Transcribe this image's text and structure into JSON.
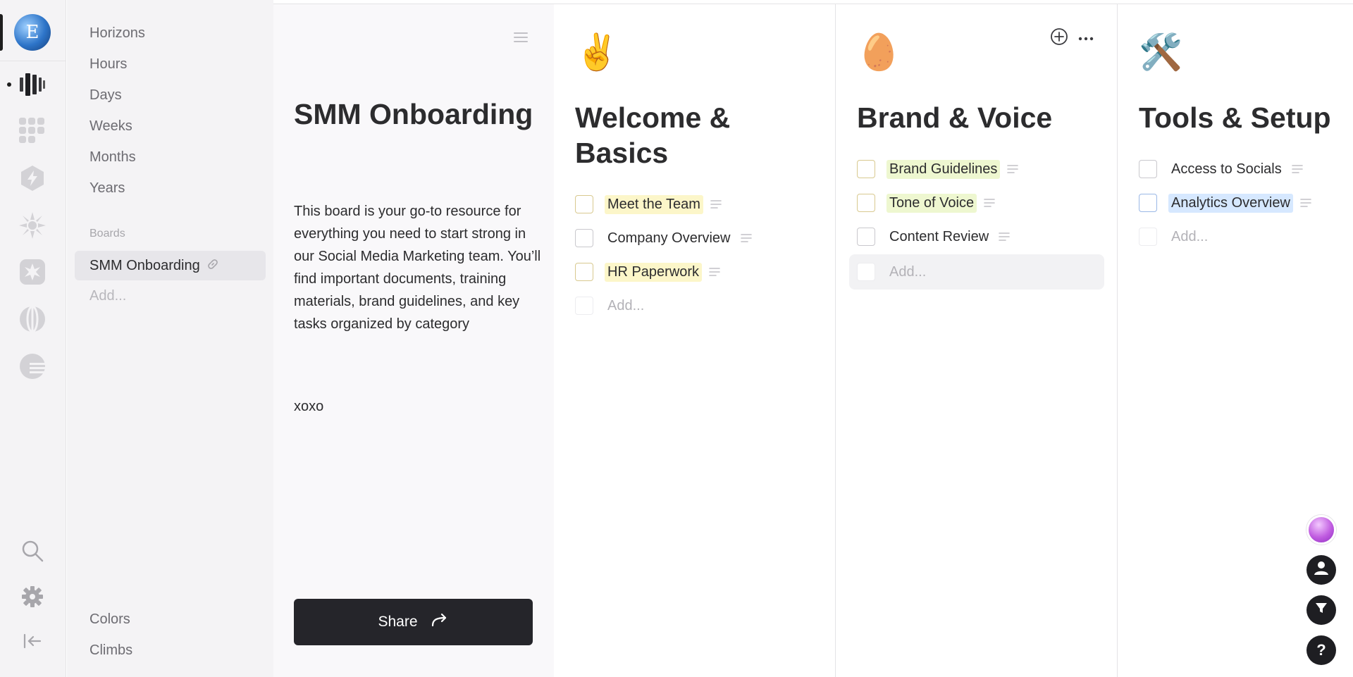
{
  "rail": {
    "avatar_letter": "E",
    "icons": [
      "timeline-icon",
      "grid-icon",
      "bolt-icon",
      "snowflake-icon",
      "sparkle-icon",
      "globe-icon",
      "sunset-icon"
    ],
    "bottom_icons": [
      "search-icon",
      "gear-icon",
      "collapse-icon"
    ]
  },
  "sidebar": {
    "nav": [
      "Horizons",
      "Hours",
      "Days",
      "Weeks",
      "Months",
      "Years"
    ],
    "boards_heading": "Boards",
    "active_board": "SMM Onboarding",
    "add_label": "Add...",
    "footer": [
      "Colors",
      "Climbs"
    ]
  },
  "intro": {
    "title": "SMM Onboarding",
    "description": "This board is your go-to resource for everything you need to start strong in our Social Media Marketing team. You’ll find important documents, training materials, brand guidelines, and key tasks organized by category",
    "signoff": "xoxo",
    "share_label": "Share"
  },
  "columns": [
    {
      "emoji": "✌️",
      "title": "Welcome & Basics",
      "tasks": [
        {
          "label": "Meet the Team",
          "highlight": "yellow"
        },
        {
          "label": "Company Overview",
          "highlight": "none"
        },
        {
          "label": "HR Paperwork",
          "highlight": "yellow"
        }
      ],
      "add_label": "Add..."
    },
    {
      "emoji": "🥚",
      "title": "Brand & Voice",
      "tasks": [
        {
          "label": "Brand Guidelines",
          "highlight": "green"
        },
        {
          "label": "Tone of Voice",
          "highlight": "green"
        },
        {
          "label": "Content Review",
          "highlight": "none"
        }
      ],
      "add_label": "Add..."
    },
    {
      "emoji": "🛠️",
      "title": "Tools & Setup",
      "tasks": [
        {
          "label": "Access to Socials",
          "highlight": "none"
        },
        {
          "label": "Analytics Overview",
          "highlight": "blue"
        }
      ],
      "add_label": "Add..."
    }
  ],
  "floating": {
    "help_label": "?"
  },
  "colors": {
    "accent_dark": "#25252a",
    "highlight_yellow": "#fcf6c9",
    "highlight_green": "#eef7d0",
    "highlight_blue": "#d6e8ff"
  }
}
